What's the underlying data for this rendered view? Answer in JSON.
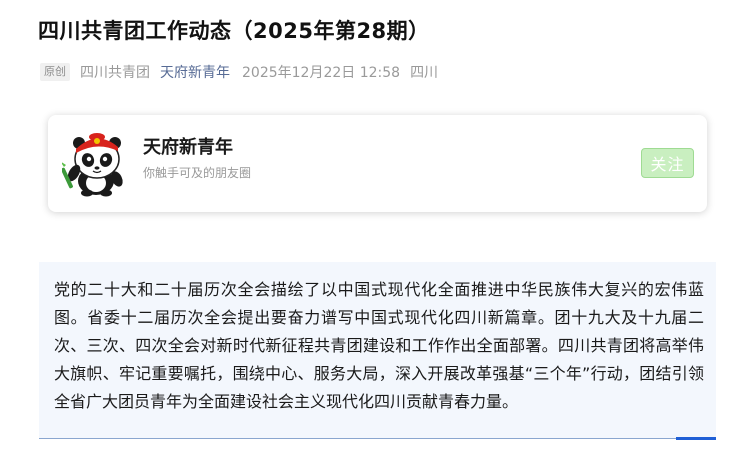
{
  "article": {
    "title": "四川共青团工作动态（2025年第28期）"
  },
  "meta": {
    "badge": "原创",
    "author": "四川共青团",
    "account": "天府新青年",
    "datetime": "2025年12月22日 12:58",
    "location": "四川"
  },
  "profile_card": {
    "name": "天府新青年",
    "description": "你触手可及的朋友圈",
    "follow_label": "关注",
    "avatar_icon": "panda-mascot-icon"
  },
  "colors": {
    "link": "#576b95",
    "follow_bg": "#c9efc0",
    "content_bg": "#f3f7fd",
    "accent": "#1f5fd6"
  },
  "content": {
    "paragraph": "党的二十大和二十届历次全会描绘了以中国式现代化全面推进中华民族伟大复兴的宏伟蓝图。省委十二届历次全会提出要奋力谱写中国式现代化四川新篇章。团十九大及十九届二次、三次、四次全会对新时代新征程共青团建设和工作作出全面部署。四川共青团将高举伟大旗帜、牢记重要嘱托，围绕中心、服务大局，深入开展改革强基“三个年”行动，团结引领全省广大团员青年为全面建设社会主义现代化四川贡献青春力量。"
  }
}
